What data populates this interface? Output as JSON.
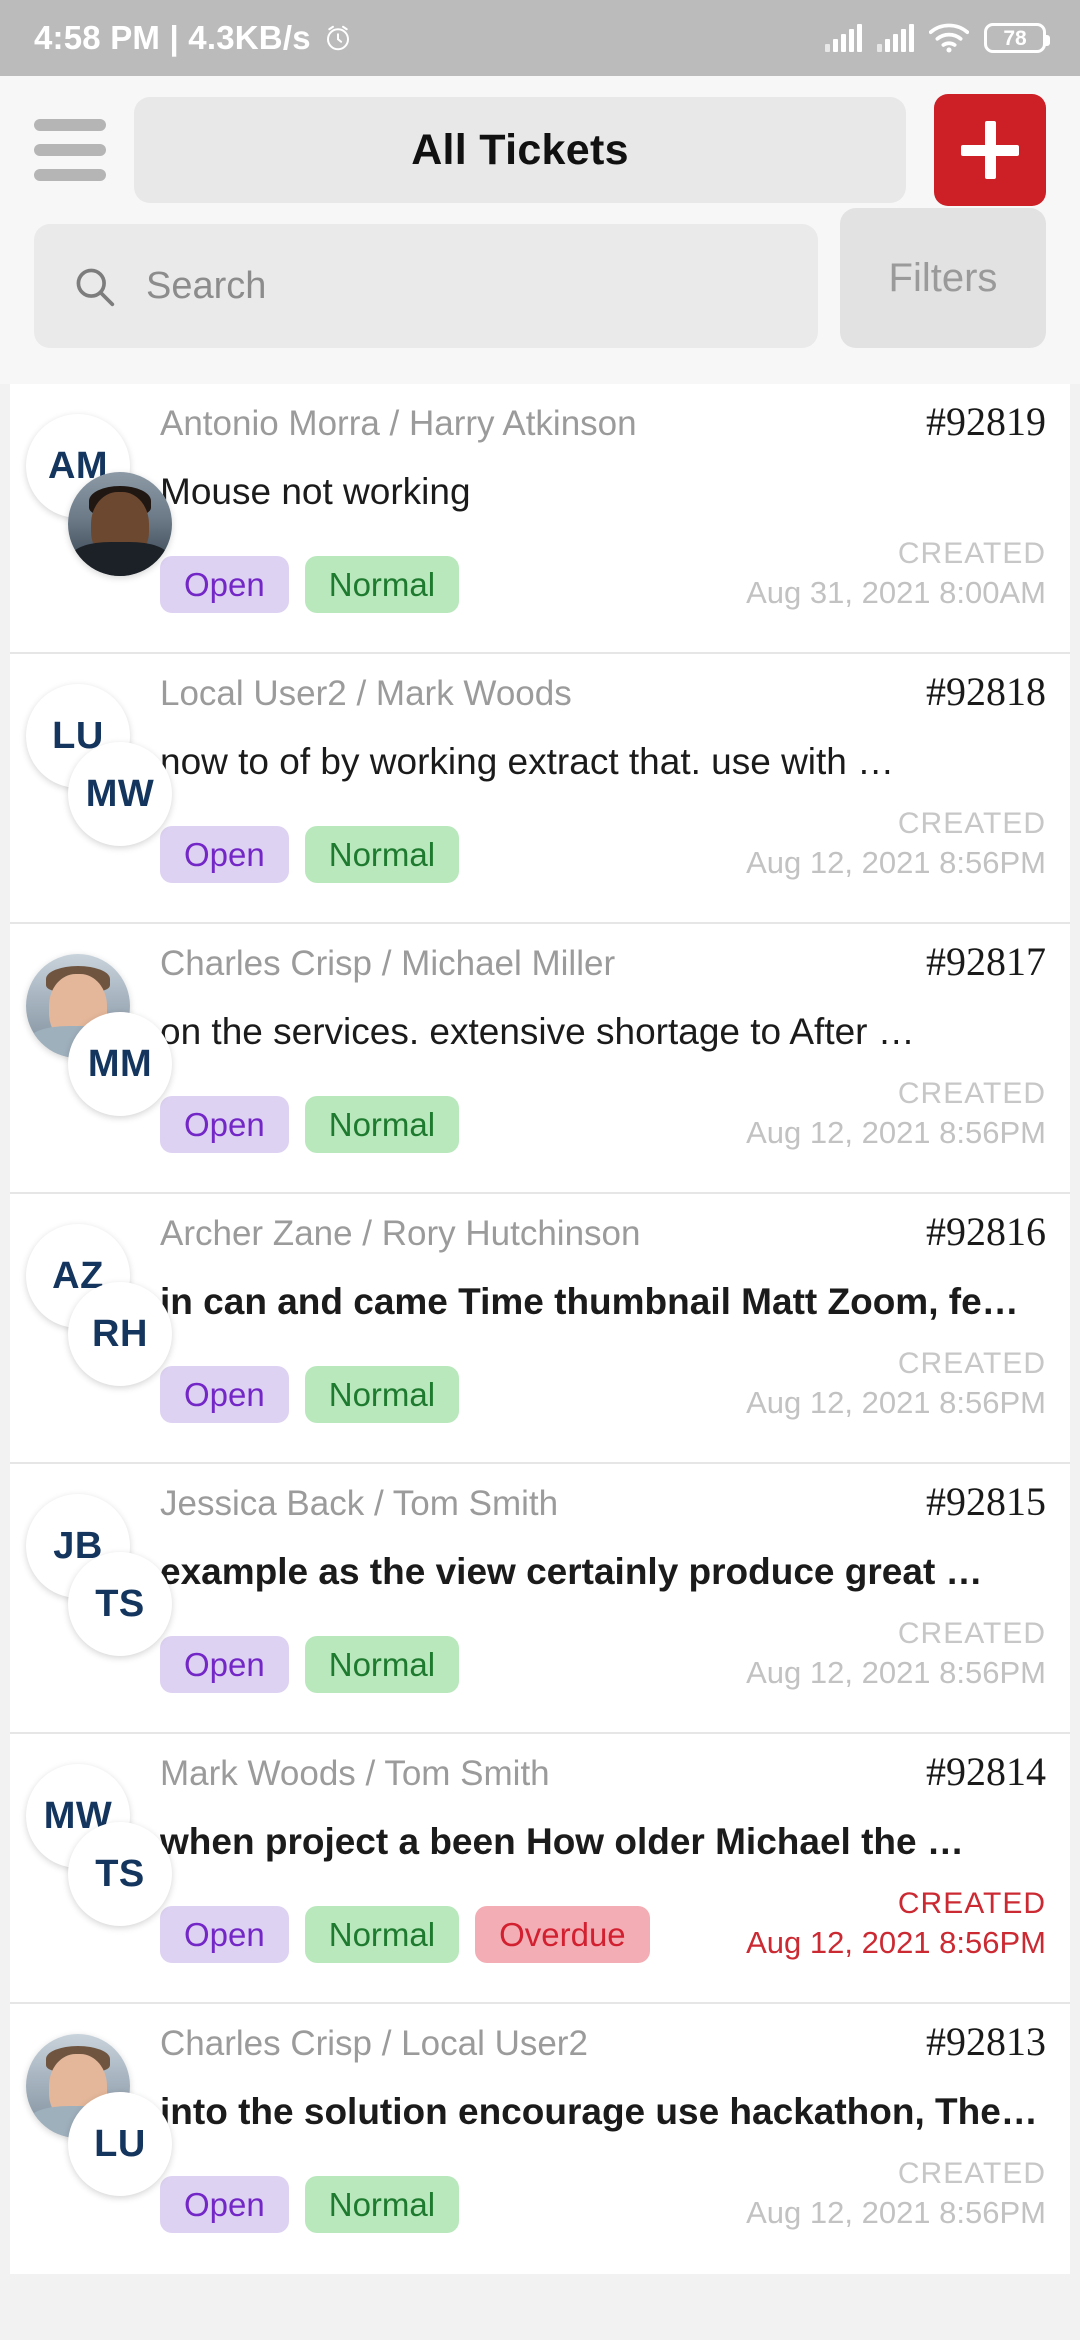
{
  "status_bar": {
    "time": "4:58 PM | 4.3KB/s",
    "alarm_icon": "alarm-icon",
    "signal_icon": "signal-bars-icon",
    "wifi_icon": "wifi-icon",
    "battery_level": "78"
  },
  "header": {
    "menu_icon": "hamburger-menu-icon",
    "title": "All Tickets",
    "add_icon": "plus-icon"
  },
  "search": {
    "icon": "search-icon",
    "placeholder": "Search",
    "filters_label": "Filters"
  },
  "colors": {
    "accent": "#cc2026",
    "open_bg": "#ded2f2",
    "open_fg": "#7327c7",
    "normal_bg": "#b9e8bd",
    "normal_fg": "#1e7a2e",
    "overdue_bg": "#f2aeb4",
    "overdue_fg": "#d32030",
    "initials": "#14355e"
  },
  "created_label": "CREATED",
  "tickets": [
    {
      "people": "Antonio Morra / Harry Atkinson",
      "id": "#92819",
      "subject": "Mouse not working",
      "bold": false,
      "badges": [
        "Open",
        "Normal"
      ],
      "created": "Aug 31, 2021 8:00AM",
      "overdue": false,
      "avatar1": {
        "type": "initials",
        "text": "AM"
      },
      "avatar2": {
        "type": "photo",
        "tone": "dark",
        "text": ""
      }
    },
    {
      "people": "Local User2 / Mark Woods",
      "id": "#92818",
      "subject": "now to of by working extract that. use with …",
      "bold": false,
      "badges": [
        "Open",
        "Normal"
      ],
      "created": "Aug 12, 2021 8:56PM",
      "overdue": false,
      "avatar1": {
        "type": "initials",
        "text": "LU"
      },
      "avatar2": {
        "type": "initials",
        "text": "MW"
      }
    },
    {
      "people": "Charles Crisp / Michael Miller",
      "id": "#92817",
      "subject": "on the services. extensive shortage to After …",
      "bold": false,
      "badges": [
        "Open",
        "Normal"
      ],
      "created": "Aug 12, 2021 8:56PM",
      "overdue": false,
      "avatar1": {
        "type": "photo",
        "tone": "light",
        "text": ""
      },
      "avatar2": {
        "type": "initials",
        "text": "MM"
      }
    },
    {
      "people": "Archer Zane / Rory Hutchinson",
      "id": "#92816",
      "subject": "in can and came Time thumbnail Matt Zoom, fe…",
      "bold": true,
      "badges": [
        "Open",
        "Normal"
      ],
      "created": "Aug 12, 2021 8:56PM",
      "overdue": false,
      "avatar1": {
        "type": "initials",
        "text": "AZ"
      },
      "avatar2": {
        "type": "initials",
        "text": "RH"
      }
    },
    {
      "people": "Jessica Back / Tom Smith",
      "id": "#92815",
      "subject": "example as the view certainly produce great …",
      "bold": true,
      "badges": [
        "Open",
        "Normal"
      ],
      "created": "Aug 12, 2021 8:56PM",
      "overdue": false,
      "avatar1": {
        "type": "initials",
        "text": "JB"
      },
      "avatar2": {
        "type": "initials",
        "text": "TS"
      }
    },
    {
      "people": "Mark Woods / Tom Smith",
      "id": "#92814",
      "subject": "when project a been How older Michael the …",
      "bold": true,
      "badges": [
        "Open",
        "Normal",
        "Overdue"
      ],
      "created": "Aug 12, 2021 8:56PM",
      "overdue": true,
      "avatar1": {
        "type": "initials",
        "text": "MW"
      },
      "avatar2": {
        "type": "initials",
        "text": "TS"
      }
    },
    {
      "people": "Charles Crisp / Local User2",
      "id": "#92813",
      "subject": "into the solution encourage use hackathon, The…",
      "bold": true,
      "badges": [
        "Open",
        "Normal"
      ],
      "created": "Aug 12, 2021 8:56PM",
      "overdue": false,
      "avatar1": {
        "type": "photo",
        "tone": "light",
        "text": ""
      },
      "avatar2": {
        "type": "initials",
        "text": "LU"
      }
    }
  ]
}
